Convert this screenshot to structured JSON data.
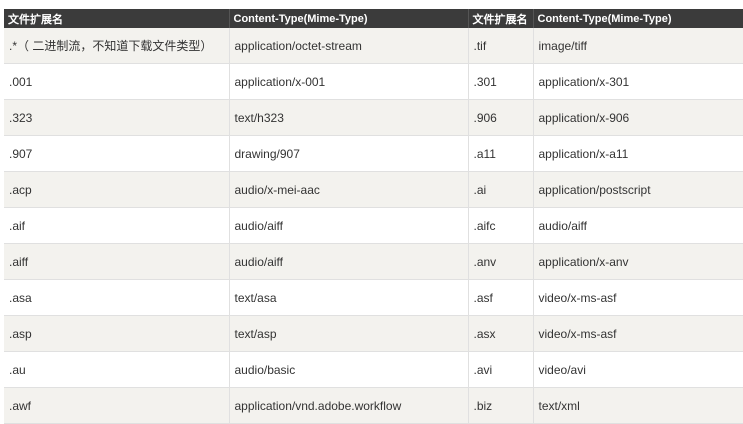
{
  "table": {
    "headers": [
      "文件扩展名",
      "Content-Type(Mime-Type)",
      "文件扩展名",
      "Content-Type(Mime-Type)"
    ],
    "rows": [
      [
        ".*（ 二进制流，不知道下载文件类型）",
        "application/octet-stream",
        ".tif",
        "image/tiff"
      ],
      [
        ".001",
        "application/x-001",
        ".301",
        "application/x-301"
      ],
      [
        ".323",
        "text/h323",
        ".906",
        "application/x-906"
      ],
      [
        ".907",
        "drawing/907",
        ".a11",
        "application/x-a11"
      ],
      [
        ".acp",
        "audio/x-mei-aac",
        ".ai",
        "application/postscript"
      ],
      [
        ".aif",
        "audio/aiff",
        ".aifc",
        "audio/aiff"
      ],
      [
        ".aiff",
        "audio/aiff",
        ".anv",
        "application/x-anv"
      ],
      [
        ".asa",
        "text/asa",
        ".asf",
        "video/x-ms-asf"
      ],
      [
        ".asp",
        "text/asp",
        ".asx",
        "video/x-ms-asf"
      ],
      [
        ".au",
        "audio/basic",
        ".avi",
        "video/avi"
      ],
      [
        ".awf",
        "application/vnd.adobe.workflow",
        ".biz",
        "text/xml"
      ]
    ]
  }
}
